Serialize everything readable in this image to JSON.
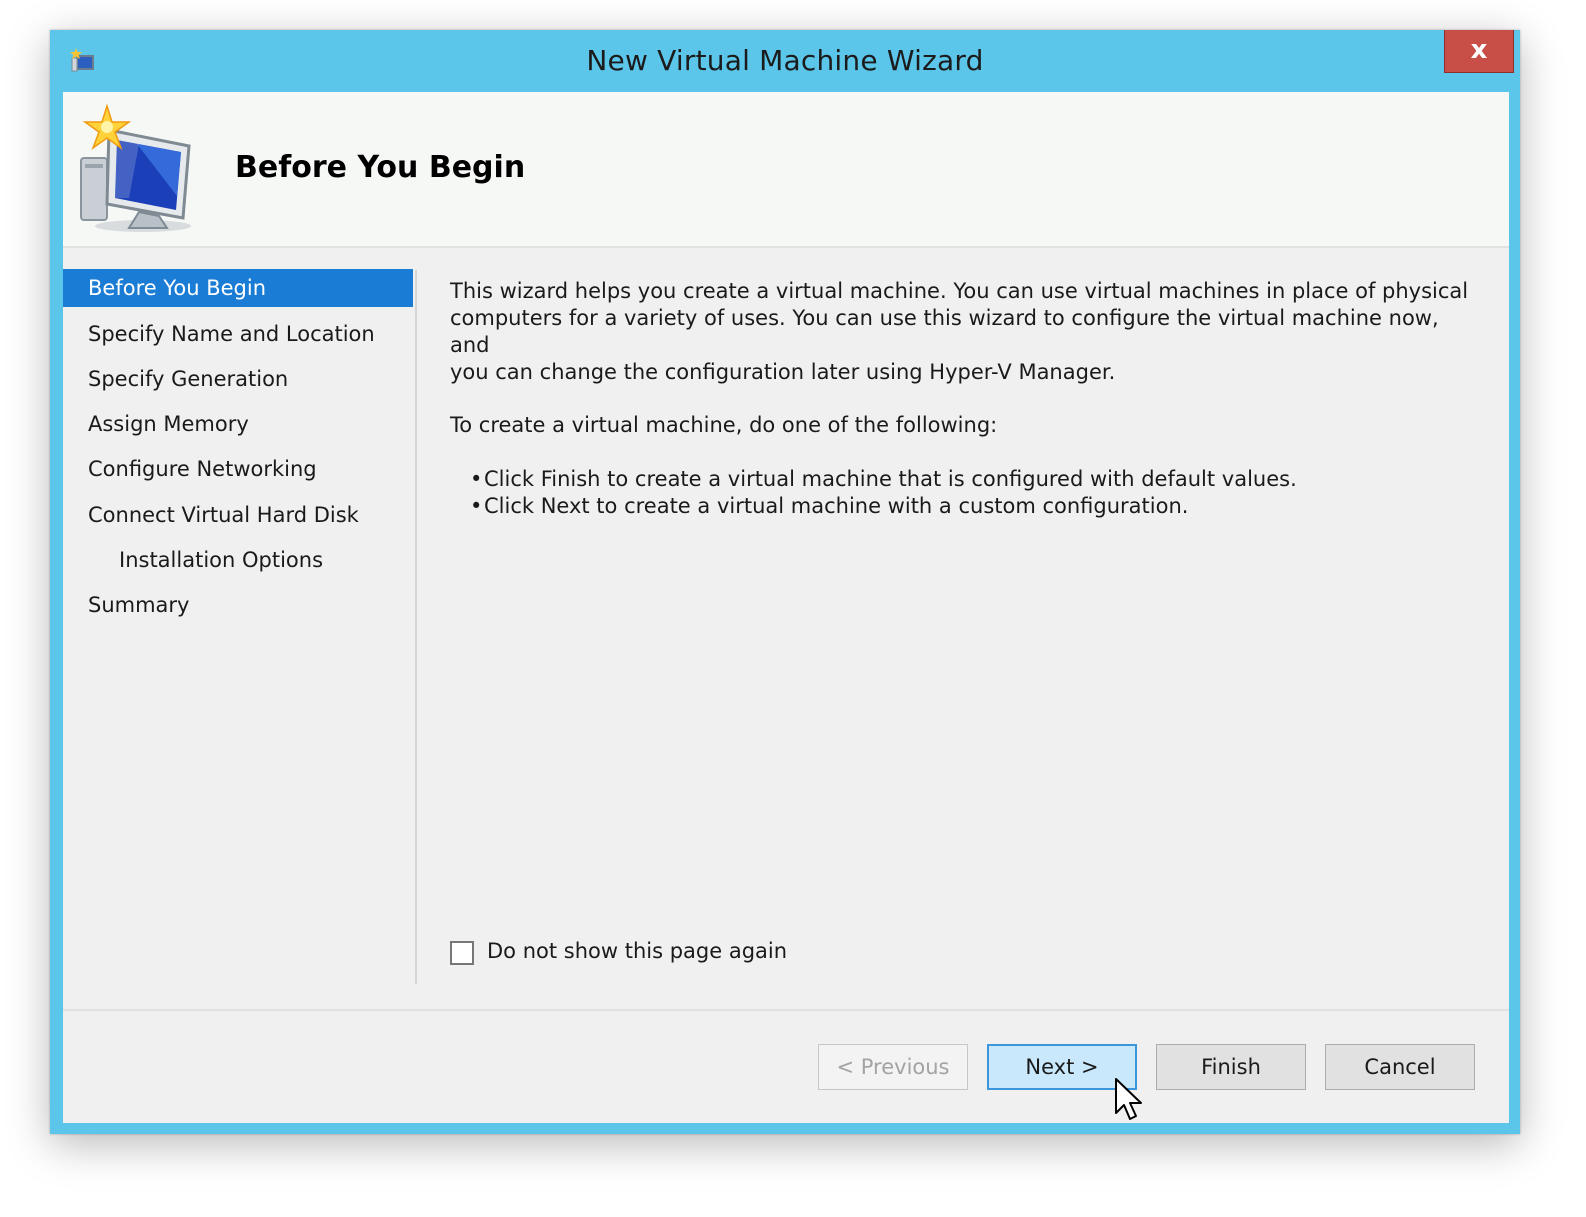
{
  "window": {
    "title": "New Virtual Machine Wizard",
    "close_label": "x"
  },
  "header": {
    "title": "Before You Begin",
    "icon": "new-virtual-machine-icon"
  },
  "steps": [
    {
      "label": "Before You Begin",
      "selected": true
    },
    {
      "label": "Specify Name and Location",
      "selected": false
    },
    {
      "label": "Specify Generation",
      "selected": false
    },
    {
      "label": "Assign Memory",
      "selected": false
    },
    {
      "label": "Configure Networking",
      "selected": false
    },
    {
      "label": "Connect Virtual Hard Disk",
      "selected": false
    },
    {
      "label": "Installation Options",
      "selected": false
    },
    {
      "label": "Summary",
      "selected": false
    }
  ],
  "content": {
    "intro_line1": "This wizard helps you create a virtual machine. You can use virtual machines in place of physical",
    "intro_line2": "computers for a variety of uses. You can use this wizard to configure the virtual machine now, and",
    "intro_line3": "you can change the configuration later using Hyper-V Manager.",
    "instruction": "To create a virtual machine, do one of the following:",
    "bullets": [
      "Click Finish to create a virtual machine that is configured with default values.",
      "Click Next to create a virtual machine with a custom configuration."
    ]
  },
  "options": {
    "dont_show_label": "Do not show this page again",
    "dont_show_checked": false
  },
  "buttons": {
    "previous": "< Previous",
    "next": "Next >",
    "finish": "Finish",
    "cancel": "Cancel"
  },
  "colors": {
    "frame": "#5cc6ea",
    "selected_step": "#1a7cd4",
    "close_button": "#c74f48",
    "focused_button": "#c9e8fb"
  }
}
